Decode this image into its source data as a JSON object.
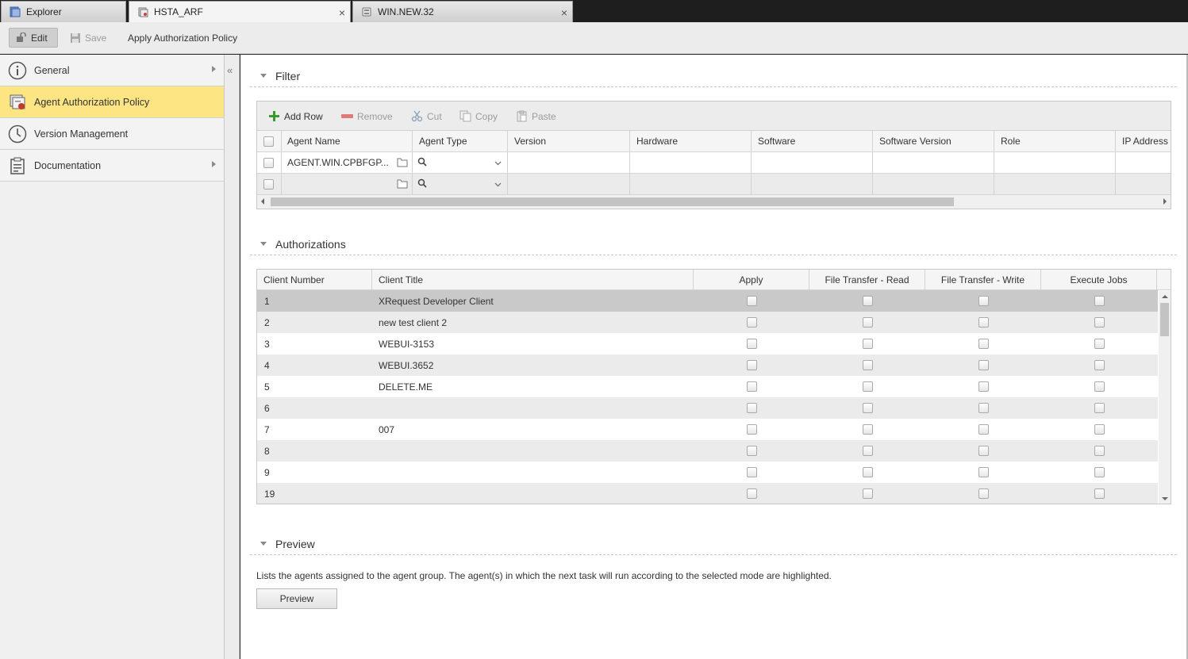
{
  "tabs": [
    {
      "label": "Explorer",
      "icon": "explorer-icon"
    },
    {
      "label": "HSTA_ARF",
      "icon": "agent-group-icon"
    },
    {
      "label": "WIN.NEW.32",
      "icon": "agent-icon"
    }
  ],
  "toolbar": {
    "edit_label": "Edit",
    "save_label": "Save",
    "apply_label": "Apply Authorization Policy"
  },
  "sidebar": {
    "items": [
      {
        "label": "General",
        "icon": "info-icon",
        "has_arrow": true
      },
      {
        "label": "Agent Authorization Policy",
        "icon": "authorization-icon",
        "has_arrow": false,
        "active": true
      },
      {
        "label": "Version Management",
        "icon": "clock-icon",
        "has_arrow": false
      },
      {
        "label": "Documentation",
        "icon": "clipboard-icon",
        "has_arrow": true
      }
    ],
    "collapse_glyph": "«"
  },
  "filter": {
    "title": "Filter",
    "toolbar": {
      "add_row": "Add Row",
      "remove": "Remove",
      "cut": "Cut",
      "copy": "Copy",
      "paste": "Paste"
    },
    "columns": [
      "Agent Name",
      "Agent Type",
      "Version",
      "Hardware",
      "Software",
      "Software Version",
      "Role",
      "IP Address"
    ],
    "rows": [
      {
        "agent_name": "AGENT.WIN.CPBFGP...",
        "agent_type": ""
      },
      {
        "agent_name": "",
        "agent_type": ""
      }
    ]
  },
  "authorizations": {
    "title": "Authorizations",
    "columns": [
      "Client Number",
      "Client Title",
      "Apply",
      "File Transfer - Read",
      "File Transfer - Write",
      "Execute Jobs"
    ],
    "rows": [
      {
        "number": "1",
        "title": "XRequest Developer Client"
      },
      {
        "number": "2",
        "title": "new test client 2"
      },
      {
        "number": "3",
        "title": "WEBUI-3153"
      },
      {
        "number": "4",
        "title": "WEBUI.3652"
      },
      {
        "number": "5",
        "title": "DELETE.ME"
      },
      {
        "number": "6",
        "title": ""
      },
      {
        "number": "7",
        "title": "007"
      },
      {
        "number": "8",
        "title": ""
      },
      {
        "number": "9",
        "title": ""
      },
      {
        "number": "19",
        "title": ""
      }
    ]
  },
  "preview": {
    "title": "Preview",
    "description": "Lists the agents assigned to the agent group. The agent(s) in which the next task will run according to the selected mode are highlighted.",
    "button_label": "Preview"
  },
  "colors": {
    "active_sidebar": "#fde583",
    "selected_row": "#c9c9c9",
    "add_icon": "#3a9a2f",
    "remove_icon": "#d9534f"
  }
}
